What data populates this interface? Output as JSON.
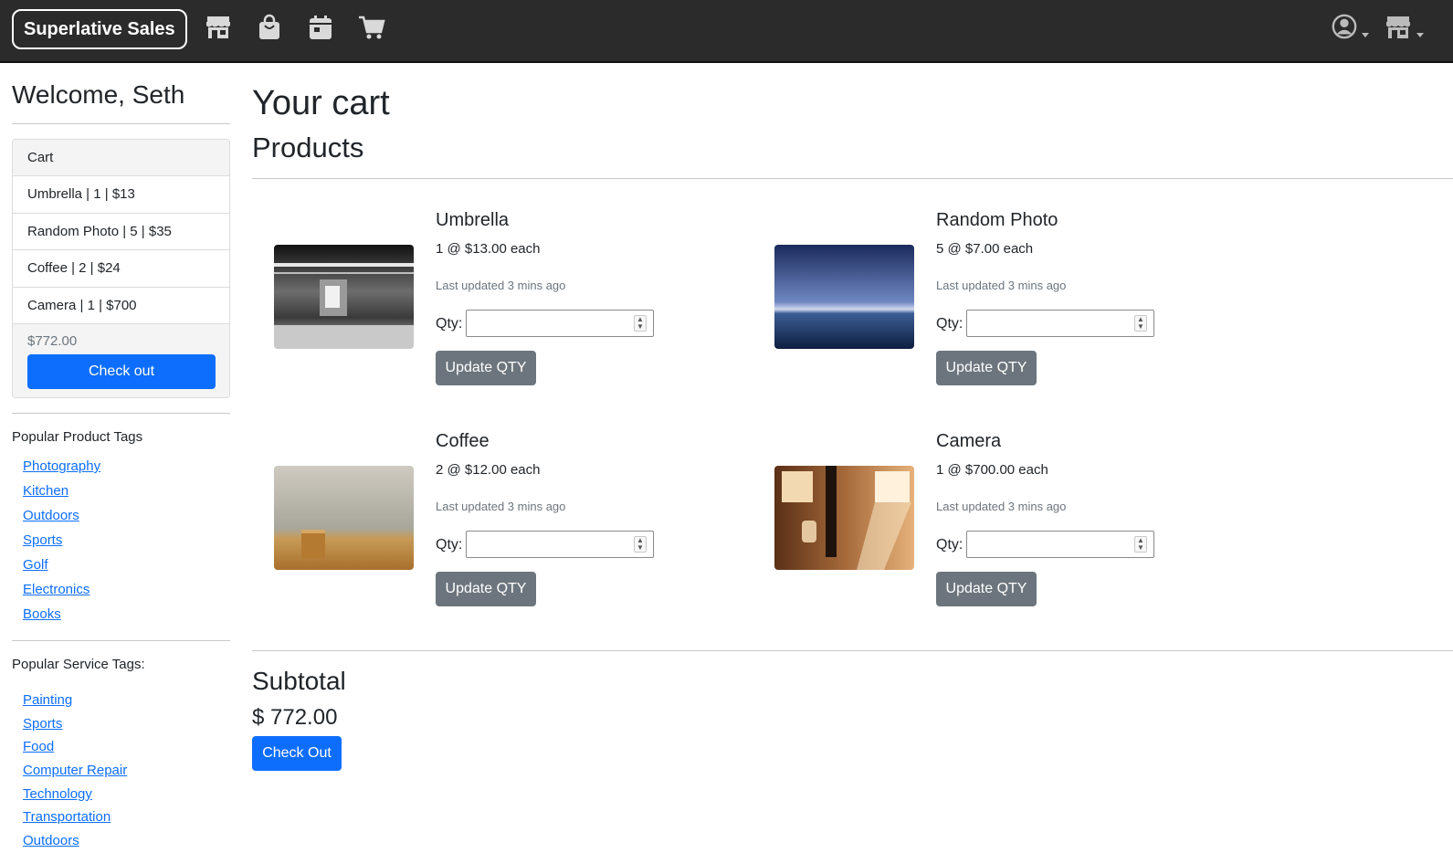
{
  "header": {
    "brand": "Superlative Sales",
    "nav_icons": [
      "store-icon",
      "shopping-bag-icon",
      "calendar-icon",
      "cart-icon"
    ],
    "right_icons": [
      "account-icon",
      "store-menu-icon"
    ]
  },
  "sidebar": {
    "welcome": "Welcome, Seth",
    "cart": {
      "header": "Cart",
      "items": [
        {
          "label": "Umbrella | 1 | $13"
        },
        {
          "label": "Random Photo | 5 | $35"
        },
        {
          "label": "Coffee | 2 | $24"
        },
        {
          "label": "Camera | 1 | $700"
        }
      ],
      "total": "$772.00",
      "checkout_label": "Check out"
    },
    "product_tags": {
      "title": "Popular Product Tags",
      "items": [
        "Photography",
        "Kitchen",
        "Outdoors",
        "Sports",
        "Golf",
        "Electronics",
        "Books"
      ]
    },
    "service_tags": {
      "title": "Popular Service Tags:",
      "items": [
        "Painting",
        "Sports",
        "Food",
        "Computer Repair",
        "Technology",
        "Transportation",
        "Outdoors"
      ]
    }
  },
  "main": {
    "title": "Your cart",
    "section": "Products",
    "qty_label": "Qty:",
    "update_label": "Update QTY",
    "products": [
      {
        "name": "Umbrella",
        "price": "1 @ $13.00 each",
        "updated": "Last updated 3 mins ago",
        "qty": ""
      },
      {
        "name": "Random Photo",
        "price": "5 @ $7.00 each",
        "updated": "Last updated 3 mins ago",
        "qty": ""
      },
      {
        "name": "Coffee",
        "price": "2 @ $12.00 each",
        "updated": "Last updated 3 mins ago",
        "qty": ""
      },
      {
        "name": "Camera",
        "price": "1 @ $700.00 each",
        "updated": "Last updated 3 mins ago",
        "qty": ""
      }
    ],
    "subtotal_title": "Subtotal",
    "subtotal_value": "$ 772.00",
    "checkout_label": "Check Out"
  },
  "colors": {
    "navbar": "#2b2b2b",
    "primary": "#0d6efd",
    "secondary": "#6c757d"
  }
}
